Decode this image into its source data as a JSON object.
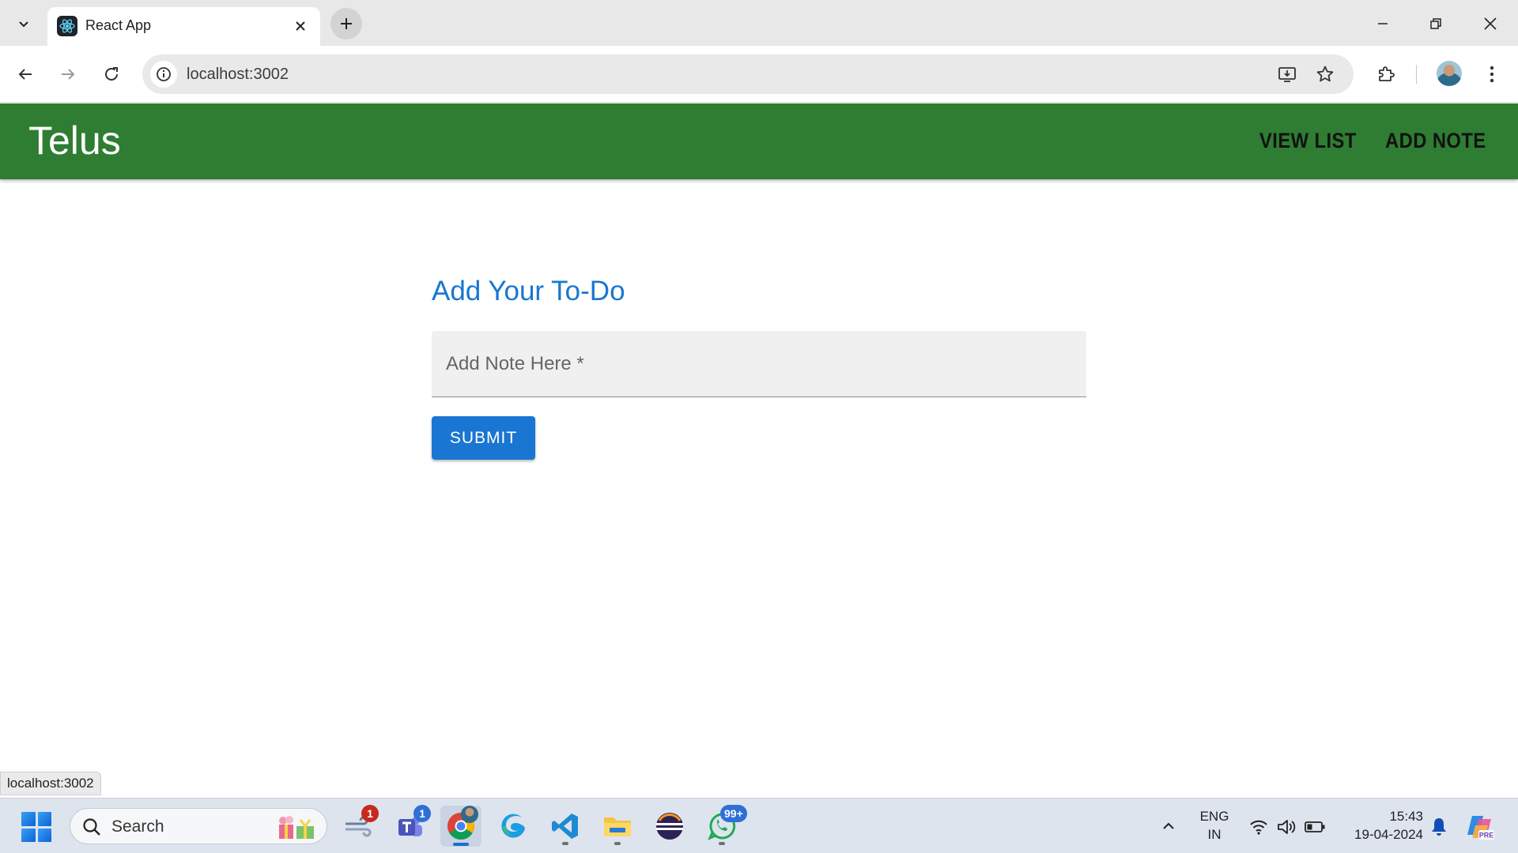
{
  "browser": {
    "tab_title": "React App",
    "url": "localhost:3002",
    "status_url": "localhost:3002"
  },
  "app": {
    "brand": "Telus",
    "nav": [
      {
        "label": "VIEW LIST"
      },
      {
        "label": "ADD NOTE"
      }
    ],
    "form": {
      "title": "Add Your To-Do",
      "note_placeholder": "Add Note Here *",
      "submit_label": "SUBMIT"
    },
    "colors": {
      "app_bar": "#2e7d32",
      "primary": "#1976d2"
    }
  },
  "taskbar": {
    "search_label": "Search",
    "apps": [
      {
        "name": "widgets",
        "badge": "1"
      },
      {
        "name": "teams",
        "badge": "1"
      },
      {
        "name": "chrome",
        "badge": ""
      },
      {
        "name": "edge",
        "badge": ""
      },
      {
        "name": "vscode",
        "badge": ""
      },
      {
        "name": "file-explorer",
        "badge": ""
      },
      {
        "name": "eclipse",
        "badge": ""
      },
      {
        "name": "whatsapp",
        "badge": "99+"
      }
    ],
    "language": {
      "line1": "ENG",
      "line2": "IN"
    },
    "clock": {
      "time": "15:43",
      "date": "19-04-2024"
    }
  }
}
